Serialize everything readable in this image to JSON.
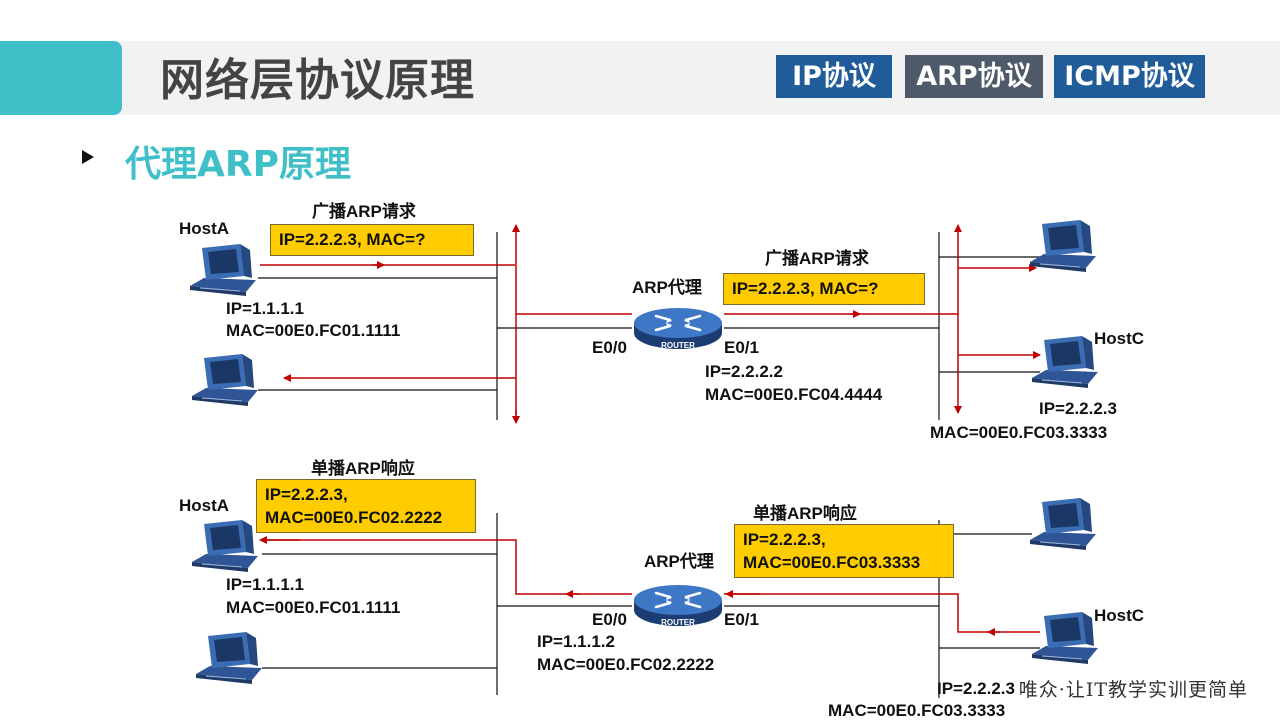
{
  "header": {
    "title": "网络层协议原理",
    "tabs": [
      {
        "label": "IP协议"
      },
      {
        "label": "ARP协议"
      },
      {
        "label": "ICMP协议"
      }
    ]
  },
  "subtitle": "代理ARP原理",
  "request": {
    "hostA_label": "HostA",
    "box1_title": "广播ARP请求",
    "box1_text": "IP=2.2.2.3, MAC=?",
    "hostA_ip": "IP=1.1.1.1",
    "hostA_mac": "MAC=00E0.FC01.1111",
    "router_label": "ARP代理",
    "box2_title": "广播ARP请求",
    "box2_text": "IP=2.2.2.3, MAC=?",
    "e00": "E0/0",
    "e01": "E0/1",
    "router_ip": "IP=2.2.2.2",
    "router_mac": "MAC=00E0.FC04.4444",
    "hostC_label": "HostC",
    "hostC_ip": "IP=2.2.2.3",
    "hostC_mac": "MAC=00E0.FC03.3333"
  },
  "reply": {
    "hostA_label": "HostA",
    "box1_title": "单播ARP响应",
    "box1_line1": "IP=2.2.2.3,",
    "box1_line2": "MAC=00E0.FC02.2222",
    "hostA_ip": "IP=1.1.1.1",
    "hostA_mac": "MAC=00E0.FC01.1111",
    "router_label": "ARP代理",
    "box2_title": "单播ARP响应",
    "box2_line1": "IP=2.2.2.3,",
    "box2_line2": "MAC=00E0.FC03.3333",
    "e00": "E0/0",
    "e01": "E0/1",
    "router_ip": "IP=1.1.1.2",
    "router_mac": "MAC=00E0.FC02.2222",
    "hostC_label": "HostC",
    "hostC_ip": "IP=2.2.2.3",
    "hostC_mac": "MAC=00E0.FC03.3333"
  },
  "router_badge": "ROUTER",
  "footer": "唯众·让IT教学实训更简单",
  "colors": {
    "accent": "#3fbfc8",
    "tab": "#1f5c99",
    "tab_active": "#4e5a6a",
    "box": "#ffcc00",
    "arrow": "#c00000",
    "computer": "#2f5597"
  }
}
